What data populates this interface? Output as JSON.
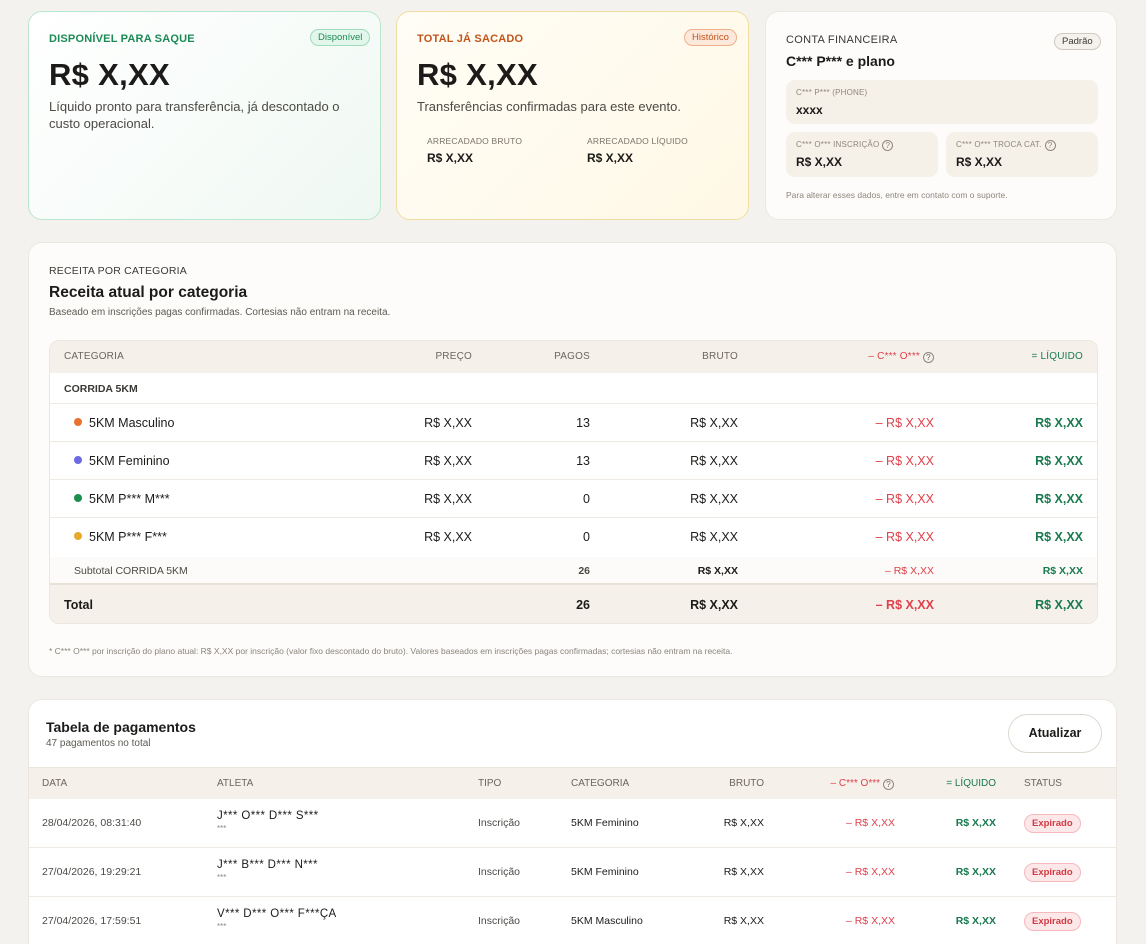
{
  "summary": {
    "available": {
      "kicker": "DISPONÍVEL PARA SAQUE",
      "badge": "Disponível",
      "amount": "R$ X,XX",
      "description_line1": "Líquido pronto para transferência, já descontado o",
      "description_line2": "custo operacional."
    },
    "withdrawn": {
      "kicker": "TOTAL JÁ SACADO",
      "badge": "Histórico",
      "amount": "R$ X,XX",
      "description": "Transferências confirmadas para este evento.",
      "gross_label": "ARRECADADO BRUTO",
      "gross_value": "R$ X,XX",
      "net_label": "ARRECADADO LÍQUIDO",
      "net_value": "R$ X,XX"
    },
    "account": {
      "title": "CONTA FINANCEIRA",
      "badge": "Padrão",
      "plan_name": "C*** P*** e plano",
      "phone_label": "C*** P*** (PHONE)",
      "phone_value": "xxxx",
      "fee_registration_label": "C*** O*** INSCRIÇÃO",
      "fee_registration_value": "R$ X,XX",
      "fee_change_label": "C*** O*** TROCA CAT.",
      "fee_change_value": "R$ X,XX",
      "help_glyph": "?",
      "note": "Para alterar esses dados, entre em contato com o suporte."
    }
  },
  "revenue": {
    "kicker": "RECEITA POR CATEGORIA",
    "title": "Receita atual por categoria",
    "subtitle": "Baseado em inscrições pagas confirmadas. Cortesias não entram na receita.",
    "columns": {
      "category": "CATEGORIA",
      "price": "PREÇO",
      "paid": "PAGOS",
      "gross": "BRUTO",
      "fee": "– C*** O***",
      "net": "= LÍQUIDO"
    },
    "group": "CORRIDA 5KM",
    "rows": [
      {
        "name": "5KM Masculino",
        "dot": "#e8712f",
        "price": "R$ X,XX",
        "paid": "13",
        "gross": "R$ X,XX",
        "fee": "– R$ X,XX",
        "net": "R$ X,XX"
      },
      {
        "name": "5KM Feminino",
        "dot": "#6b6ae0",
        "price": "R$ X,XX",
        "paid": "13",
        "gross": "R$ X,XX",
        "fee": "– R$ X,XX",
        "net": "R$ X,XX"
      },
      {
        "name": "5KM P*** M***",
        "dot": "#1c8f4f",
        "price": "R$ X,XX",
        "paid": "0",
        "gross": "R$ X,XX",
        "fee": "– R$ X,XX",
        "net": "R$ X,XX"
      },
      {
        "name": "5KM P*** F***",
        "dot": "#e8a82a",
        "price": "R$ X,XX",
        "paid": "0",
        "gross": "R$ X,XX",
        "fee": "– R$ X,XX",
        "net": "R$ X,XX"
      }
    ],
    "subtotal": {
      "label": "Subtotal CORRIDA 5KM",
      "paid": "26",
      "gross": "R$ X,XX",
      "fee": "– R$ X,XX",
      "net": "R$ X,XX"
    },
    "total": {
      "label": "Total",
      "paid": "26",
      "gross": "R$ X,XX",
      "fee": "– R$ X,XX",
      "net": "R$ X,XX"
    },
    "footnote": "* C*** O*** por inscrição do plano atual: R$ X,XX por inscrição (valor fixo descontado do bruto). Valores baseados em inscrições pagas confirmadas; cortesias não entram na receita."
  },
  "payments": {
    "title": "Tabela de pagamentos",
    "subtitle": "47 pagamentos no total",
    "refresh_label": "Atualizar",
    "columns": {
      "date": "DATA",
      "athlete": "ATLETA",
      "type": "TIPO",
      "category": "CATEGORIA",
      "gross": "BRUTO",
      "fee": "– C*** O***",
      "net": "= LÍQUIDO",
      "status": "STATUS"
    },
    "rows": [
      {
        "date": "28/04/2026, 08:31:40",
        "athlete": "J*** O*** D*** S***",
        "athlete_sub": "***",
        "type": "Inscrição",
        "category": "5KM Feminino",
        "gross": "R$ X,XX",
        "fee": "– R$ X,XX",
        "net": "R$ X,XX",
        "status": "Expirado"
      },
      {
        "date": "27/04/2026, 19:29:21",
        "athlete": "J*** B*** D*** N***",
        "athlete_sub": "***",
        "type": "Inscrição",
        "category": "5KM Feminino",
        "gross": "R$ X,XX",
        "fee": "– R$ X,XX",
        "net": "R$ X,XX",
        "status": "Expirado"
      },
      {
        "date": "27/04/2026, 17:59:51",
        "athlete": "V*** D*** O*** F***ÇA",
        "athlete_sub": "***",
        "type": "Inscrição",
        "category": "5KM Masculino",
        "gross": "R$ X,XX",
        "fee": "– R$ X,XX",
        "net": "R$ X,XX",
        "status": "Expirado"
      }
    ]
  },
  "colors": {
    "available_accent": "#1c8a55",
    "withdrawn_accent": "#c2541a",
    "fee_red": "#e0404a",
    "net_green": "#187a4e",
    "expired_red": "#d23a44"
  }
}
